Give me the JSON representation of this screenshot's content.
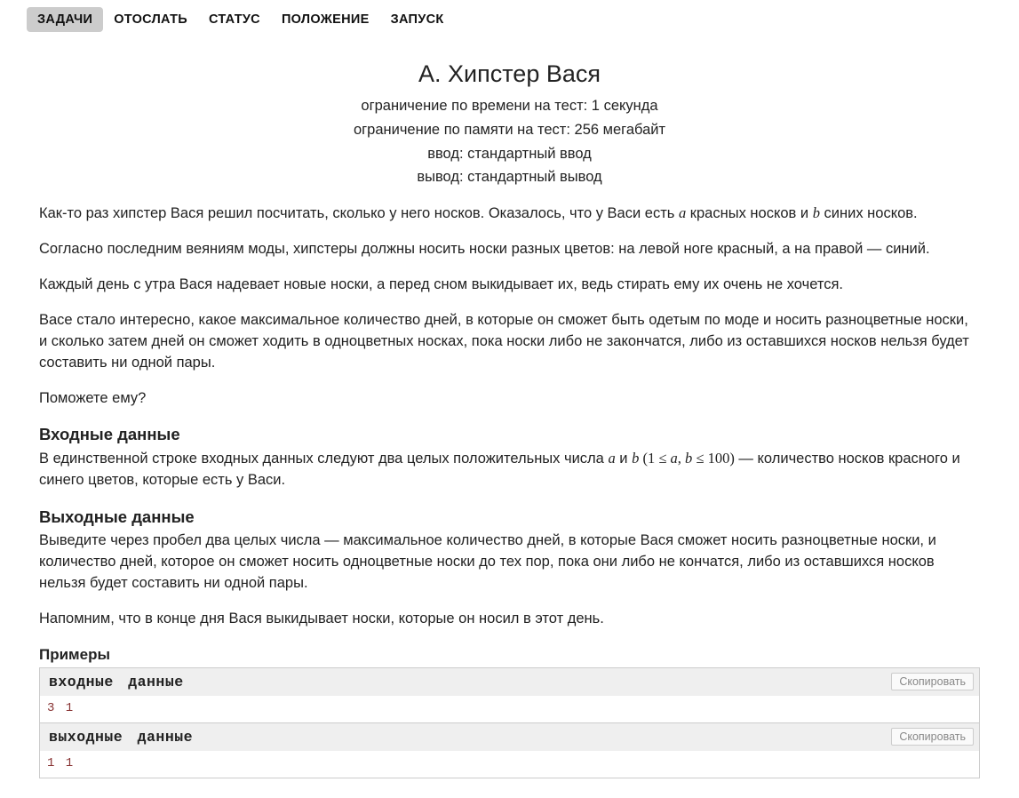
{
  "nav": {
    "items": [
      {
        "label": "ЗАДАЧИ",
        "active": true
      },
      {
        "label": "ОТОСЛАТЬ",
        "active": false
      },
      {
        "label": "СТАТУС",
        "active": false
      },
      {
        "label": "ПОЛОЖЕНИЕ",
        "active": false
      },
      {
        "label": "ЗАПУСК",
        "active": false
      }
    ]
  },
  "problem": {
    "title": "A. Хипстер Вася",
    "limits": {
      "time": "ограничение по времени на тест: 1 секунда",
      "memory": "ограничение по памяти на тест: 256 мегабайт",
      "input": "ввод: стандартный ввод",
      "output": "вывод: стандартный вывод"
    },
    "p1_a": "Как-то раз хипстер Вася решил посчитать, сколько у него носков. Оказалось, что у Васи есть ",
    "p1_var_a": "a",
    "p1_b": " красных носков и ",
    "p1_var_b": "b",
    "p1_c": " синих носков.",
    "p2": "Согласно последним веяниям моды, хипстеры должны носить носки разных цветов: на левой ноге красный, а на правой — синий.",
    "p3": "Каждый день с утра Вася надевает новые носки, а перед сном выкидывает их, ведь стирать ему их очень не хочется.",
    "p4": "Васе стало интересно, какое максимальное количество дней, в которые он сможет быть одетым по моде и носить разноцветные носки, и сколько затем дней он сможет ходить в одноцветных носках, пока носки либо не закончатся, либо из оставшихся носков нельзя будет составить ни одной пары.",
    "p5": "Поможете ему?",
    "input_header": "Входные данные",
    "input_a": "В единственной строке входных данных следуют два целых положительных числа ",
    "input_var_a": "a",
    "input_mid": " и ",
    "input_var_b": "b",
    "input_par_open": " (",
    "input_constraint": "1 ≤ a, b ≤ 100",
    "input_par_close": ")",
    "input_b": " — количество носков красного и синего цветов, которые есть у Васи.",
    "output_header": "Выходные данные",
    "output_p1": "Выведите через пробел два целых числа — максимальное количество дней, в которые Вася сможет носить разноцветные носки, и количество дней, которое он сможет носить одноцветные носки до тех пор, пока они либо не кончатся, либо из оставшихся носков нельзя будет составить ни одной пары.",
    "output_p2": "Напомним, что в конце дня Вася выкидывает носки, которые он носил в этот день.",
    "examples_header": "Примеры",
    "ex_in_label": "входные данные",
    "ex_out_label": "выходные данные",
    "copy_label": "Скопировать",
    "ex1_in": "3 1",
    "ex1_out": "1 1"
  }
}
